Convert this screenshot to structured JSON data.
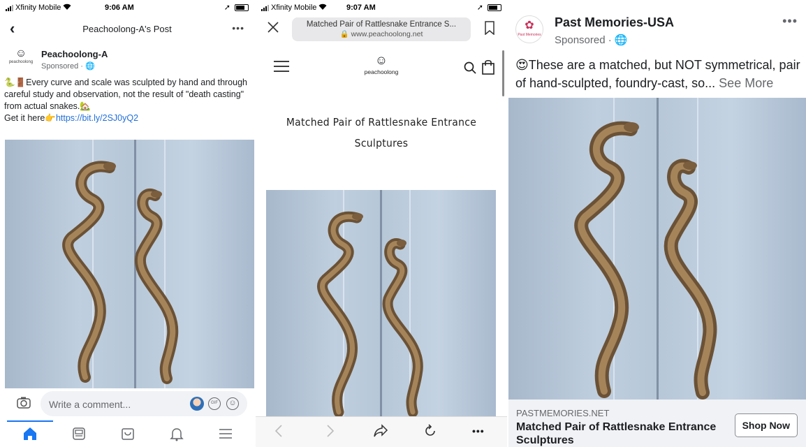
{
  "panel1": {
    "status": {
      "carrier": "Xfinity Mobile",
      "time": "9:06 AM"
    },
    "nav": {
      "title": "Peachoolong-A's Post"
    },
    "post": {
      "page_name": "Peachoolong-A",
      "logo_text": "peachoolong",
      "sponsored": "Sponsored · ",
      "text_line": "🐍🚪Every curve and scale was sculpted by hand and through careful study and observation, not the result of \"death casting\" from actual snakes.🏡",
      "get_it": "Get it here👉",
      "link": "https://bit.ly/2SJ0yQ2"
    },
    "comment": {
      "placeholder": "Write a comment...",
      "gif": "GIF"
    },
    "tabs": [
      "home-icon",
      "news-icon",
      "marketplace-icon",
      "notifications-icon",
      "menu-icon"
    ]
  },
  "panel2": {
    "status": {
      "carrier": "Xfinity Mobile",
      "time": "9:07 AM"
    },
    "url": {
      "title": "Matched Pair of Rattlesnake Entrance S...",
      "domain": "www.peachoolong.net"
    },
    "logo_text": "peachoolong",
    "product_title": "Matched Pair of Rattlesnake Entrance Sculptures"
  },
  "panel3": {
    "page_name": "Past Memories-USA",
    "logo_text": "Past Memories",
    "sponsored": "Sponsored · ",
    "text": "😍These are a matched, but NOT symmetrical, pair of hand-sculpted, foundry-cast, so...",
    "see_more": "See More",
    "link": {
      "domain": "PASTMEMORIES.NET",
      "headline": "Matched Pair of Rattlesnake Entrance Sculptures",
      "cta": "Shop Now"
    }
  },
  "colors": {
    "facebook_blue": "#1877f2",
    "link_blue": "#216fdb",
    "brand_pink": "#c8325a"
  }
}
